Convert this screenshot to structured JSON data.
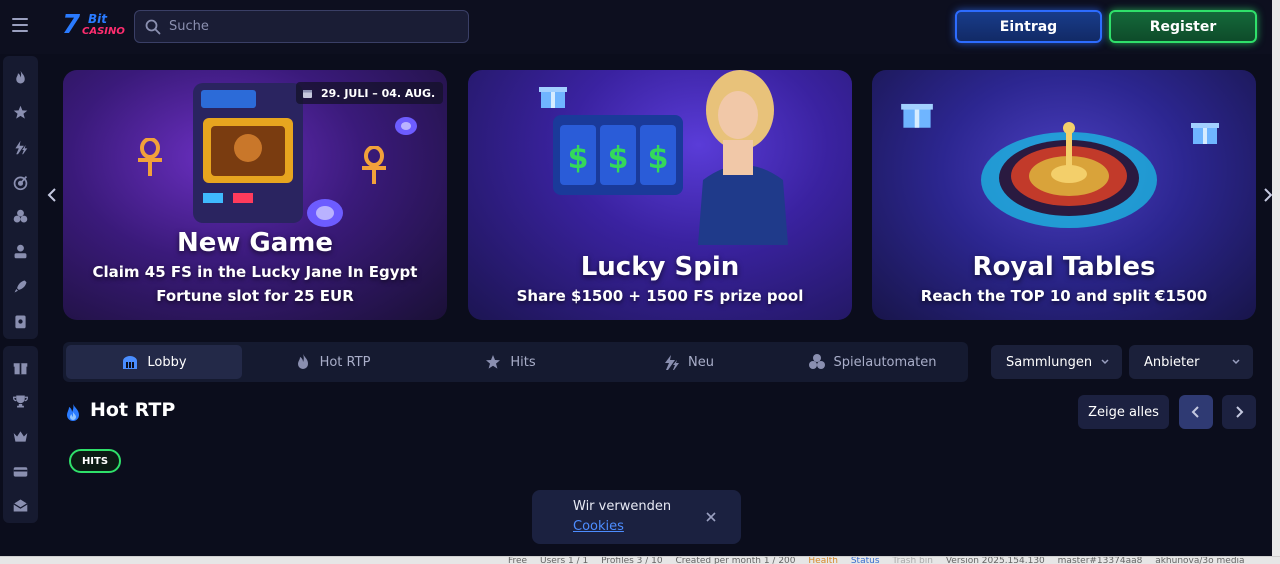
{
  "header": {
    "logo": {
      "num": "7",
      "bit": "Bit",
      "casino": "CASINO"
    },
    "search_placeholder": "Suche",
    "login_label": "Eintrag",
    "register_label": "Register"
  },
  "sidebar": {
    "group1": [
      "fire-icon",
      "gamepad-icon",
      "bolt-icon",
      "target-icon",
      "cards-icon",
      "dealer-icon",
      "rocket-icon",
      "live-icon"
    ],
    "group2": [
      "gift-icon",
      "trophy-icon",
      "crown-icon",
      "card-icon",
      "mail-icon"
    ]
  },
  "banners": [
    {
      "title": "New Game",
      "subtitle": [
        "Claim 45 FS in the Lucky Jane In Egypt",
        "Fortune slot for 25 EUR"
      ],
      "date": "29. JULI – 04. AUG."
    },
    {
      "title": "Lucky Spin",
      "subtitle": [
        "Share $1500 + 1500 FS prize pool"
      ]
    },
    {
      "title": "Royal Tables",
      "subtitle": [
        "Reach the TOP 10 and split €1500"
      ]
    }
  ],
  "tabs": [
    {
      "label": "Lobby",
      "icon": "lobby-icon",
      "active": true
    },
    {
      "label": "Hot RTP",
      "icon": "flame-icon",
      "active": false
    },
    {
      "label": "Hits",
      "icon": "hits-icon",
      "active": false
    },
    {
      "label": "Neu",
      "icon": "new-icon",
      "active": false
    },
    {
      "label": "Spielautomaten",
      "icon": "cherries-icon",
      "active": false
    }
  ],
  "filters": {
    "collections": "Sammlungen",
    "providers": "Anbieter"
  },
  "section": {
    "title": "Hot RTP",
    "show_all": "Zeige alles",
    "badge": "HITS"
  },
  "cookie": {
    "text": "Wir verwenden",
    "link": "Cookies"
  },
  "footer": {
    "items": [
      "Free",
      "Users 1 / 1",
      "Profiles 3 / 10",
      "Created per month 1 / 200",
      "Health",
      "Status",
      "Trash bin",
      "Version 2025.154.130",
      "master#13374aa8",
      "akhunova/3o media"
    ]
  },
  "colors": {
    "accent_blue": "#2d6cff",
    "accent_green": "#2fe06a",
    "background": "#0b0d1c"
  }
}
